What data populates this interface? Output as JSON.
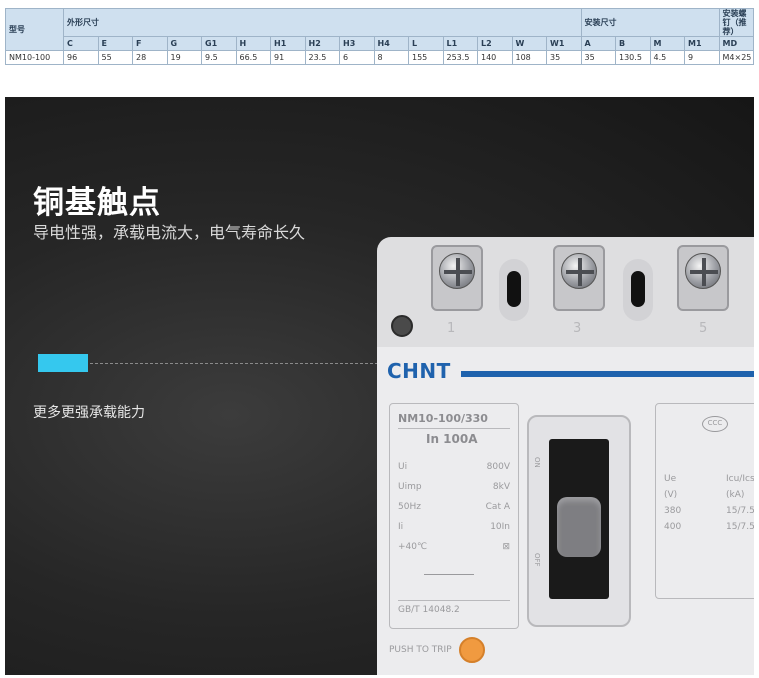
{
  "spec_table": {
    "group_headers": {
      "model": "型号",
      "outline": "外形尺寸",
      "mount": "安装尺寸",
      "screw": "安装螺钉（推荐）"
    },
    "columns": [
      "C",
      "E",
      "F",
      "G",
      "G1",
      "H",
      "H1",
      "H2",
      "H3",
      "H4",
      "L",
      "L1",
      "L2",
      "W",
      "W1",
      "A",
      "B",
      "M",
      "M1",
      "MD"
    ],
    "row": {
      "model": "NM10-100",
      "values": [
        "96",
        "55",
        "28",
        "19",
        "9.5",
        "66.5",
        "91",
        "23.5",
        "6",
        "8",
        "155",
        "253.5",
        "140",
        "108",
        "35",
        "35",
        "130.5",
        "4.5",
        "9",
        "M4×25"
      ]
    }
  },
  "banner": {
    "title": "铜基触点",
    "subtitle": "导电性强，承载电流大，电气寿命长久",
    "feature": "更多更强承载能力",
    "accent_color": "#35c8ee"
  },
  "breaker": {
    "terminal_numbers": [
      "1",
      "3",
      "5"
    ],
    "brand": "CHNT",
    "brand_color": "#1f62ad",
    "model": "NM10-100/330",
    "rating": "In  100A",
    "specs": [
      {
        "k": "Ui",
        "v": "800V"
      },
      {
        "k": "Uimp",
        "v": "8kV"
      },
      {
        "k": "50Hz",
        "v": "Cat A"
      },
      {
        "k": "Ii",
        "v": "10In"
      },
      {
        "k": "+40℃",
        "v": "⊠"
      }
    ],
    "standard": "GB/T 14048.2",
    "on_label": "ON",
    "off_label": "OFF",
    "cert": "CCC",
    "right_col1": [
      "Ue",
      "(V)",
      "380",
      "400"
    ],
    "right_col2": [
      "Icu/Ics",
      "(kA)",
      "15/7.5",
      "15/7.5"
    ],
    "push_label": "PUSH TO TRIP",
    "push_color": "#f09a40"
  }
}
